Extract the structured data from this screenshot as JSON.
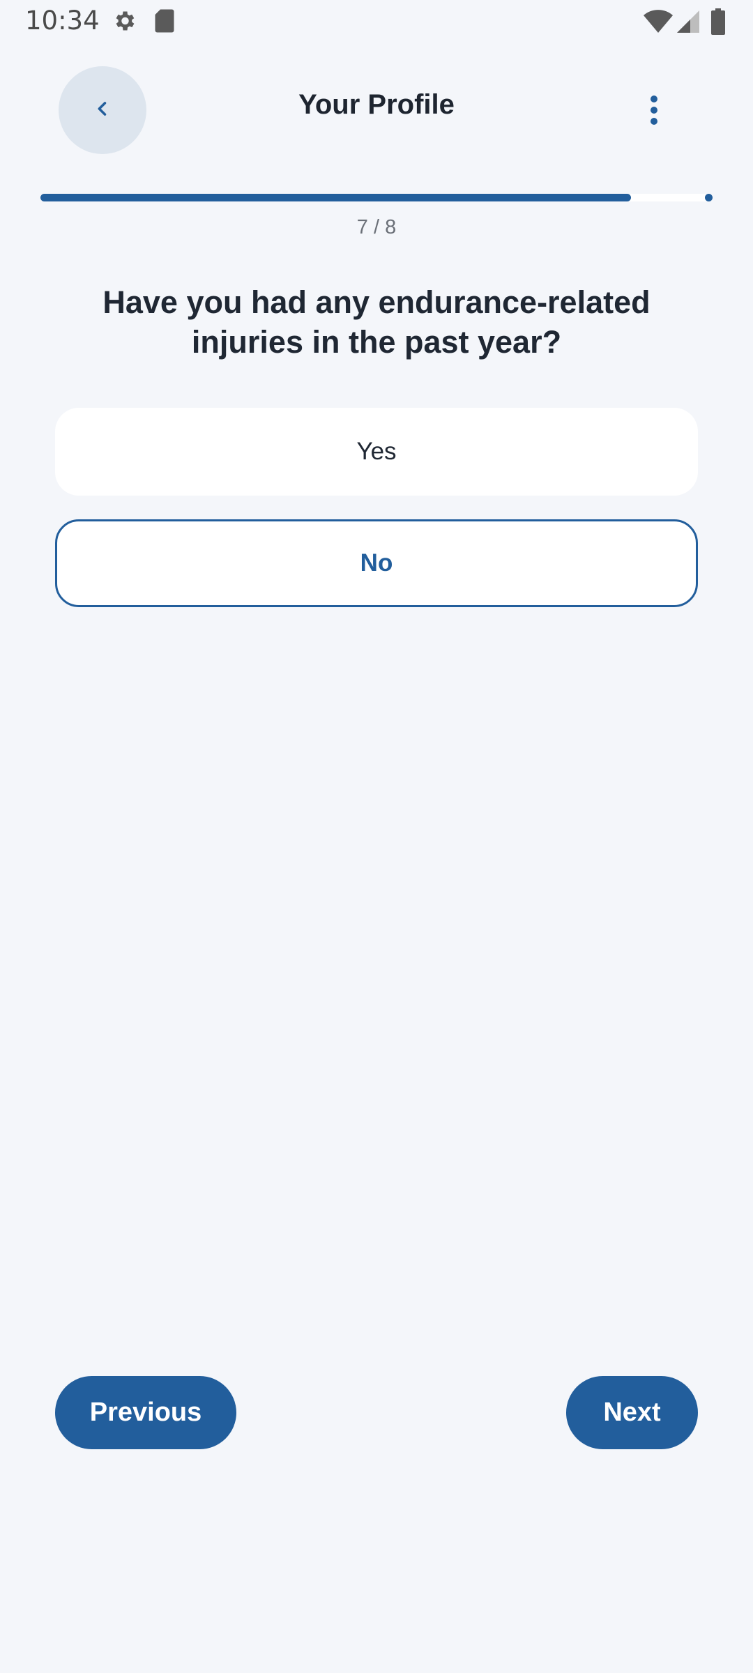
{
  "status_bar": {
    "time": "10:34",
    "icons": [
      "settings-icon",
      "sd-card-icon",
      "wifi-icon",
      "signal-icon",
      "battery-icon"
    ]
  },
  "header": {
    "title": "Your Profile",
    "back_icon": "chevron-left-icon",
    "menu_icon": "more-vert-icon"
  },
  "progress": {
    "current": 7,
    "total": 8,
    "label": "7 / 8",
    "fraction": 0.88
  },
  "question": {
    "text": "Have you had any endurance-related injuries in the past year?"
  },
  "options": [
    {
      "label": "Yes",
      "selected": false
    },
    {
      "label": "No",
      "selected": true
    }
  ],
  "navigation": {
    "previous_label": "Previous",
    "next_label": "Next"
  },
  "colors": {
    "accent": "#225e9c",
    "background": "#f4f6fa",
    "text": "#1f2733"
  }
}
